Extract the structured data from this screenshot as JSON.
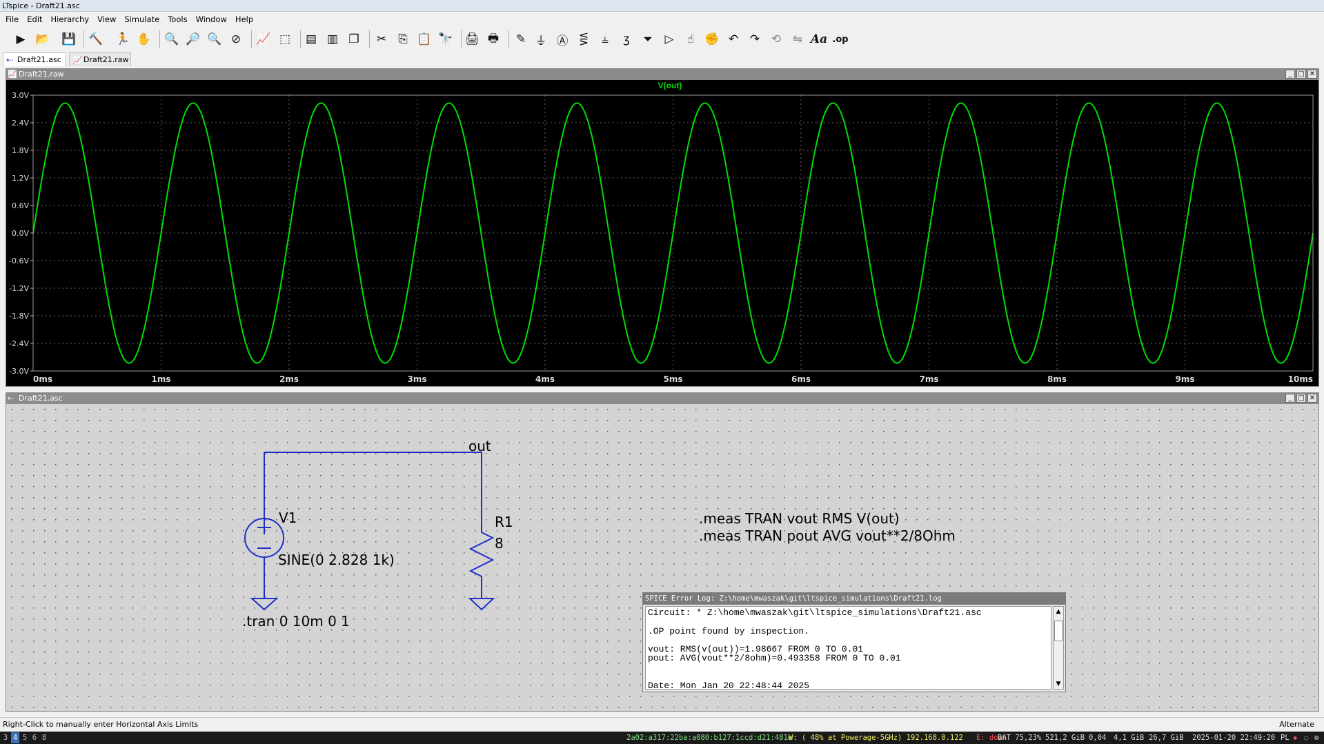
{
  "app": {
    "title": "LTspice - Draft21.asc"
  },
  "menu": [
    "File",
    "Edit",
    "Hierarchy",
    "View",
    "Simulate",
    "Tools",
    "Window",
    "Help"
  ],
  "toolbar_icons": [
    "run-icon",
    "open-icon",
    "save-icon",
    "control-panel-icon",
    "halt-icon",
    "pan-icon",
    "zoom-in-icon",
    "zoom-area-icon",
    "zoom-out-icon",
    "zoom-fit-icon",
    "autorange-icon",
    "waveform-icon",
    "tile-horizontal-icon",
    "tile-vertical-icon",
    "cascade-icon",
    "cut-icon",
    "copy-icon",
    "paste-icon",
    "find-icon",
    "print-preview-icon",
    "print-icon",
    "wire-icon",
    "ground-icon",
    "label-icon",
    "resistor-icon",
    "capacitor-icon",
    "inductor-icon",
    "diode-icon",
    "component-icon",
    "move-icon",
    "drag-icon",
    "undo-icon",
    "redo-icon",
    "rotate-icon",
    "mirror-icon",
    "text-icon",
    "spice-directive-icon"
  ],
  "tabs": [
    {
      "label": "Draft21.asc"
    },
    {
      "label": "Draft21.raw"
    }
  ],
  "waveform_window": {
    "title": "Draft21.raw",
    "trace_label": "V(out)",
    "trace_color": "#00e000"
  },
  "chart_data": {
    "type": "line",
    "title": "V(out)",
    "series": [
      {
        "name": "V(out)",
        "amplitude": 2.828,
        "frequency_hz": 1000,
        "offset": 0,
        "color": "#00e000"
      }
    ],
    "x_ticks": [
      "0ms",
      "1ms",
      "2ms",
      "3ms",
      "4ms",
      "5ms",
      "6ms",
      "7ms",
      "8ms",
      "9ms",
      "10ms"
    ],
    "y_ticks": [
      "3.0V",
      "2.4V",
      "1.8V",
      "1.2V",
      "0.6V",
      "0.0V",
      "-0.6V",
      "-1.2V",
      "-1.8V",
      "-2.4V",
      "-3.0V"
    ],
    "xlim_ms": [
      0,
      10
    ],
    "ylim_v": [
      -3.0,
      3.0
    ],
    "grid": true
  },
  "schematic_window": {
    "title": "Draft21.asc",
    "net_label": "out",
    "v1_name": "V1",
    "v1_value": "SINE(0 2.828 1k)",
    "r1_name": "R1",
    "r1_value": "8",
    "tran_directive": ".tran 0 10m 0 1",
    "meas1": ".meas TRAN vout RMS V(out)",
    "meas2": ".meas TRAN pout AVG vout**2/8Ohm",
    "wire_color": "#1e2ec8"
  },
  "error_log": {
    "title": "SPICE Error Log: Z:\\home\\mwaszak\\git\\ltspice_simulations\\Draft21.log",
    "lines": [
      "Circuit: * Z:\\home\\mwaszak\\git\\ltspice_simulations\\Draft21.asc",
      "",
      ".OP point found by inspection.",
      "",
      "vout: RMS(v(out))=1.98667 FROM 0 TO 0.01",
      "pout: AVG(vout**2/8ohm)=0.493358 FROM 0 TO 0.01",
      "",
      "",
      "Date: Mon Jan 20 22:48:44 2025"
    ]
  },
  "statusbar": {
    "left": "Right-Click to manually enter Horizontal Axis Limits",
    "right": "Alternate"
  },
  "taskbar": {
    "workspaces": [
      "3",
      "4",
      "5",
      "6",
      "8"
    ],
    "active_workspace": "4",
    "ipv6": "2a02:a317:22ba:a080:b127:1ccd:d21:481e",
    "wifi": "W: ( 48% at Powerage-5GHz) 192.168.0.122",
    "eth": "E: down",
    "battery": "BAT 75,23%",
    "disk": "521,2 GiB",
    "load": "0,04",
    "mem": "4,1 GiB",
    "disk2": "26,7 GiB",
    "datetime": "2025-01-20 22:49:20",
    "lang": "PL"
  }
}
